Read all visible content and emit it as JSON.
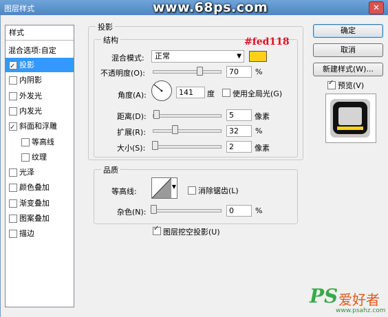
{
  "window": {
    "title": "图层样式",
    "watermark": "www.68ps.com",
    "close": "✕"
  },
  "sidebar": {
    "header": "样式",
    "blend": "混合选项:自定",
    "items": [
      {
        "label": "投影",
        "checked": true,
        "selected": true,
        "indent": 0
      },
      {
        "label": "内阴影",
        "checked": false,
        "indent": 0
      },
      {
        "label": "外发光",
        "checked": false,
        "indent": 0
      },
      {
        "label": "内发光",
        "checked": false,
        "indent": 0
      },
      {
        "label": "斜面和浮雕",
        "checked": true,
        "indent": 0
      },
      {
        "label": "等高线",
        "checked": false,
        "indent": 1
      },
      {
        "label": "纹理",
        "checked": false,
        "indent": 1
      },
      {
        "label": "光泽",
        "checked": false,
        "indent": 0
      },
      {
        "label": "颜色叠加",
        "checked": false,
        "indent": 0
      },
      {
        "label": "渐变叠加",
        "checked": false,
        "indent": 0
      },
      {
        "label": "图案叠加",
        "checked": false,
        "indent": 0
      },
      {
        "label": "描边",
        "checked": false,
        "indent": 0
      }
    ]
  },
  "main": {
    "section_title": "投影",
    "structure": {
      "legend": "结构",
      "blend_mode_label": "混合模式:",
      "blend_mode_value": "正常",
      "color": "#fed118",
      "annotation": "#fed118",
      "opacity_label": "不透明度(O):",
      "opacity_value": "70",
      "opacity_unit": "%",
      "angle_label": "角度(A):",
      "angle_value": "141",
      "angle_unit": "度",
      "global_light_label": "使用全局光(G)",
      "distance_label": "距离(D):",
      "distance_value": "5",
      "distance_unit": "像素",
      "spread_label": "扩展(R):",
      "spread_value": "32",
      "spread_unit": "%",
      "size_label": "大小(S):",
      "size_value": "2",
      "size_unit": "像素"
    },
    "quality": {
      "legend": "品质",
      "contour_label": "等高线:",
      "antialias_label": "消除锯齿(L)",
      "noise_label": "杂色(N):",
      "noise_value": "0",
      "noise_unit": "%"
    },
    "knockout_label": "图层挖空投影(U)"
  },
  "buttons": {
    "ok": "确定",
    "cancel": "取消",
    "new_style": "新建样式(W)...",
    "preview_label": "预览(V)"
  },
  "brand": {
    "ps": "PS",
    "name": "爱好者",
    "url": "www.psahz.com"
  }
}
